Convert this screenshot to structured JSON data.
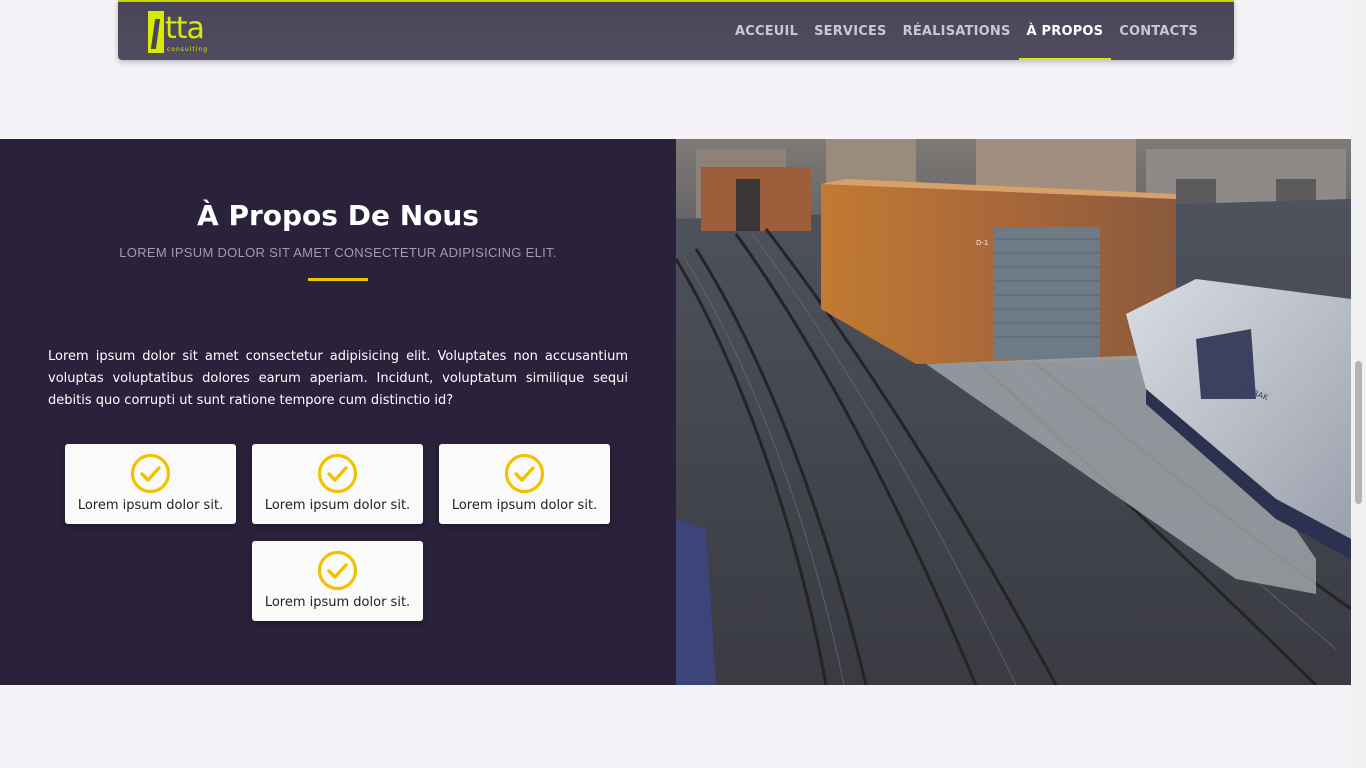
{
  "brand": {
    "logo_text": "tta",
    "logo_tagline": "consulting",
    "accent_color": "#d7ea00"
  },
  "nav": {
    "items": [
      {
        "label": "ACCEUIL",
        "active": false
      },
      {
        "label": "SERVICES",
        "active": false
      },
      {
        "label": "RÉALISATIONS",
        "active": false
      },
      {
        "label": "À PROPOS",
        "active": true
      },
      {
        "label": "CONTACTS",
        "active": false
      }
    ]
  },
  "about": {
    "title": "À Propos De Nous",
    "subtitle": "LOREM IPSUM DOLOR SIT AMET CONSECTETUR ADIPISICING ELIT.",
    "text": "Lorem ipsum dolor sit amet consectetur adipisicing elit. Voluptates non accusantium voluptas voluptatibus dolores earum aperiam. Incidunt, voluptatum similique sequi debitis quo corrupti ut sunt ratione tempore cum distinctio id?",
    "features": [
      {
        "icon": "check-circle-icon",
        "label": "Lorem ipsum dolor sit."
      },
      {
        "icon": "check-circle-icon",
        "label": "Lorem ipsum dolor sit."
      },
      {
        "icon": "check-circle-icon",
        "label": "Lorem ipsum dolor sit."
      },
      {
        "icon": "check-circle-icon",
        "label": "Lorem ipsum dolor sit."
      }
    ],
    "background_color": "#29223a",
    "highlight_color": "#f2c200"
  },
  "photo": {
    "subject": "railway-yard-photo",
    "painted_texts": [
      "D-1",
      "AMTRAK"
    ]
  }
}
